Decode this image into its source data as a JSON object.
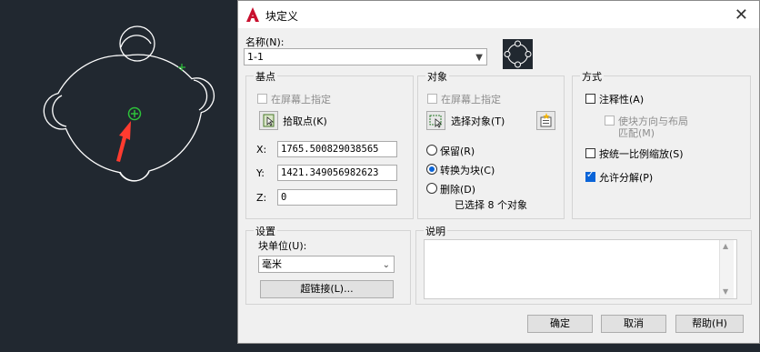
{
  "dialog": {
    "title": "块定义",
    "name_label": "名称(N):",
    "name_value": "1-1",
    "close_symbol": "✕"
  },
  "base_point": {
    "title": "基点",
    "specify_on_screen": "在屏幕上指定",
    "pick_point": "拾取点(K)",
    "x_label": "X:",
    "x_value": "1765.500829038565",
    "y_label": "Y:",
    "y_value": "1421.349056982623",
    "z_label": "Z:",
    "z_value": "0"
  },
  "objects": {
    "title": "对象",
    "specify_on_screen": "在屏幕上指定",
    "select_objects": "选择对象(T)",
    "retain": "保留(R)",
    "convert_to_block": "转换为块(C)",
    "delete": "删除(D)",
    "selected_count": "已选择 8 个对象"
  },
  "behavior": {
    "title": "方式",
    "annotative": "注释性(A)",
    "match_orientation_line1": "使块方向与布局",
    "match_orientation_line2": "匹配(M)",
    "scale_uniformly": "按统一比例缩放(S)",
    "allow_exploding": "允许分解(P)",
    "allow_exploding_checked": true
  },
  "settings": {
    "title": "设置",
    "block_unit_label": "块单位(U):",
    "block_unit_value": "毫米",
    "hyperlink": "超链接(L)..."
  },
  "description": {
    "title": "说明"
  },
  "footer": {
    "ok": "确定",
    "cancel": "取消",
    "help": "帮助(H)"
  },
  "colors": {
    "canvas_bg": "#212830",
    "shape_stroke": "#ffffff",
    "marker_green": "#2ec23a",
    "arrow_red": "#ff3b2f",
    "accent_blue": "#0a64d8"
  }
}
